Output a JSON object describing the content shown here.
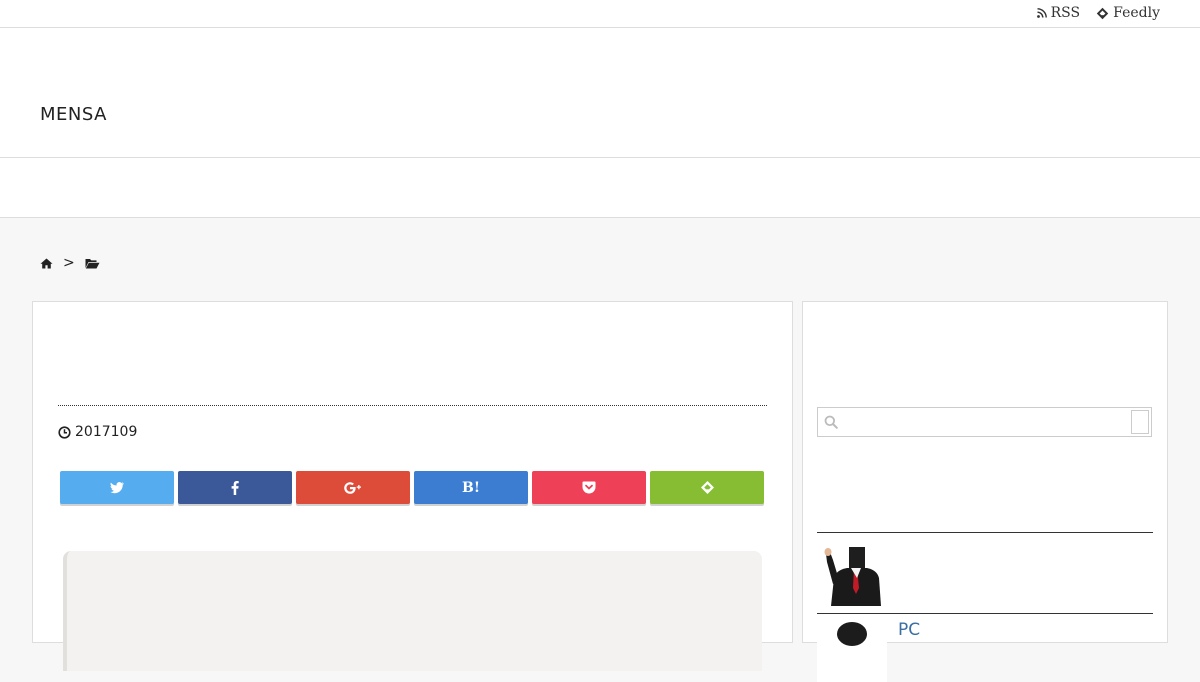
{
  "topbar": {
    "links": [
      {
        "label": "RSS",
        "icon": "rss-icon"
      },
      {
        "label": "Feedly",
        "icon": "feedly-icon"
      }
    ]
  },
  "header": {
    "site_title": "MENSA"
  },
  "breadcrumb": {
    "separator": ">",
    "home_icon": "home-icon",
    "folder_icon": "folder-open-icon"
  },
  "article": {
    "date": "2017109",
    "date_icon": "clock-icon",
    "share_buttons": [
      {
        "name": "twitter",
        "icon": "twitter-icon",
        "color": "#55acee"
      },
      {
        "name": "facebook",
        "icon": "facebook-icon",
        "color": "#3b5998"
      },
      {
        "name": "google-plus",
        "icon": "google-plus-icon",
        "color": "#dd4b39"
      },
      {
        "name": "hatena",
        "label": "B!",
        "color": "#3c7dd1"
      },
      {
        "name": "pocket",
        "icon": "pocket-icon",
        "color": "#ee4056"
      },
      {
        "name": "feedly",
        "icon": "feedly-icon",
        "color": "#87bd33"
      }
    ]
  },
  "sidebar": {
    "search": {
      "placeholder": "",
      "value": "",
      "icon": "search-icon"
    },
    "posts": [
      {
        "title": "",
        "thumb": "suited-figure-bag-head"
      },
      {
        "title": "PC",
        "thumb": "dark-hair-figure"
      }
    ],
    "link_color": "#3a6ea5"
  }
}
